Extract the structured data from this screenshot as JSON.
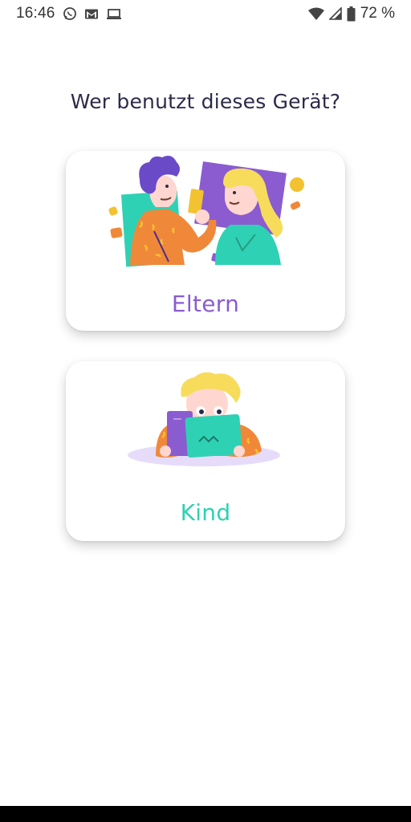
{
  "status_bar": {
    "time": "16:46",
    "battery_percent": "72 %",
    "icons": [
      "whatsapp-icon",
      "gmail-icon",
      "laptop-icon",
      "wifi-icon",
      "signal-icon",
      "battery-icon"
    ]
  },
  "screen": {
    "question": "Wer benutzt dieses Gerät?"
  },
  "options": {
    "parent": {
      "label": "Eltern"
    },
    "child": {
      "label": "Kind"
    }
  },
  "colors": {
    "parent_label": "#8a5cd0",
    "child_label": "#2fd1b4",
    "question_text": "#2d2a4a"
  }
}
